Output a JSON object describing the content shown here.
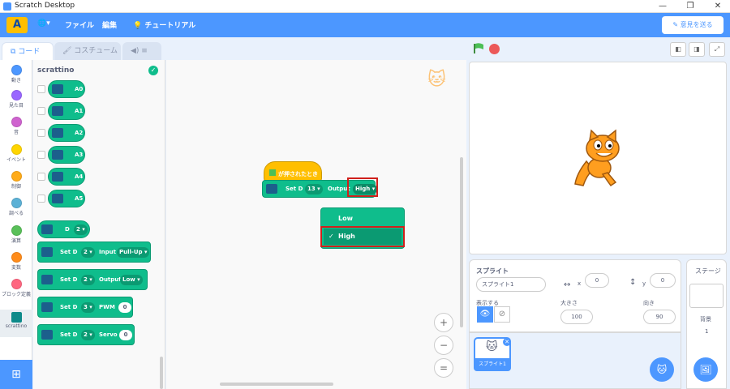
{
  "window": {
    "title": "Scratch Desktop",
    "min": "—",
    "max": "❐",
    "close": "✕"
  },
  "menubar": {
    "logo": "A",
    "globe": "🌐▾",
    "file": "ファイル",
    "edit": "編集",
    "tutorial": "チュートリアル",
    "feedback": "意見を送る"
  },
  "tabs": {
    "code": "コード",
    "costume": "コスチューム",
    "sound": "◀) ≡"
  },
  "categories": [
    {
      "label": "動き",
      "color": "#4c97ff"
    },
    {
      "label": "見た目",
      "color": "#9966ff"
    },
    {
      "label": "音",
      "color": "#cf63cf"
    },
    {
      "label": "イベント",
      "color": "#ffd500"
    },
    {
      "label": "制御",
      "color": "#ffab19"
    },
    {
      "label": "調べる",
      "color": "#5cb1d6"
    },
    {
      "label": "演算",
      "color": "#59c059"
    },
    {
      "label": "変数",
      "color": "#ff8c1a"
    },
    {
      "label": "ブロック定義",
      "color": "#ff6680"
    },
    {
      "label": "scrattino",
      "color": "#0d8a8a"
    }
  ],
  "palette": {
    "title": "scrattino",
    "reporters": [
      "A0",
      "A1",
      "A2",
      "A3",
      "A4",
      "A5"
    ],
    "d_reporter": {
      "label": "D",
      "value": "2"
    },
    "set_input": {
      "set": "Set D",
      "pin": "2",
      "mode": "Input",
      "value": "Pull-Up"
    },
    "set_output": {
      "set": "Set D",
      "pin": "2",
      "mode": "Output",
      "value": "Low"
    },
    "set_pwm": {
      "set": "Set D",
      "pin": "3",
      "mode": "PWM",
      "value": "0"
    },
    "set_servo": {
      "set": "Set D",
      "pin": "2",
      "mode": "Servo",
      "value": "0"
    }
  },
  "script": {
    "hat": "が押されたとき",
    "set": "Set D",
    "pin": "13",
    "mode": "Output",
    "value": "High"
  },
  "dropdown": {
    "options": [
      "Low",
      "High"
    ],
    "selected": "High",
    "check": "✓"
  },
  "zoom": {
    "in": "+",
    "out": "−",
    "reset": "="
  },
  "sprite_panel": {
    "title": "スプライト",
    "name": "スプライト1",
    "x_label": "x",
    "x": "0",
    "y_label": "y",
    "y": "0",
    "show_label": "表示する",
    "size_label": "大きさ",
    "size": "100",
    "direction_label": "向き",
    "direction": "90",
    "thumb_label": "スプライト1"
  },
  "stage_pane": {
    "title": "ステージ",
    "backdrops_label": "背景",
    "backdrops": "1"
  }
}
